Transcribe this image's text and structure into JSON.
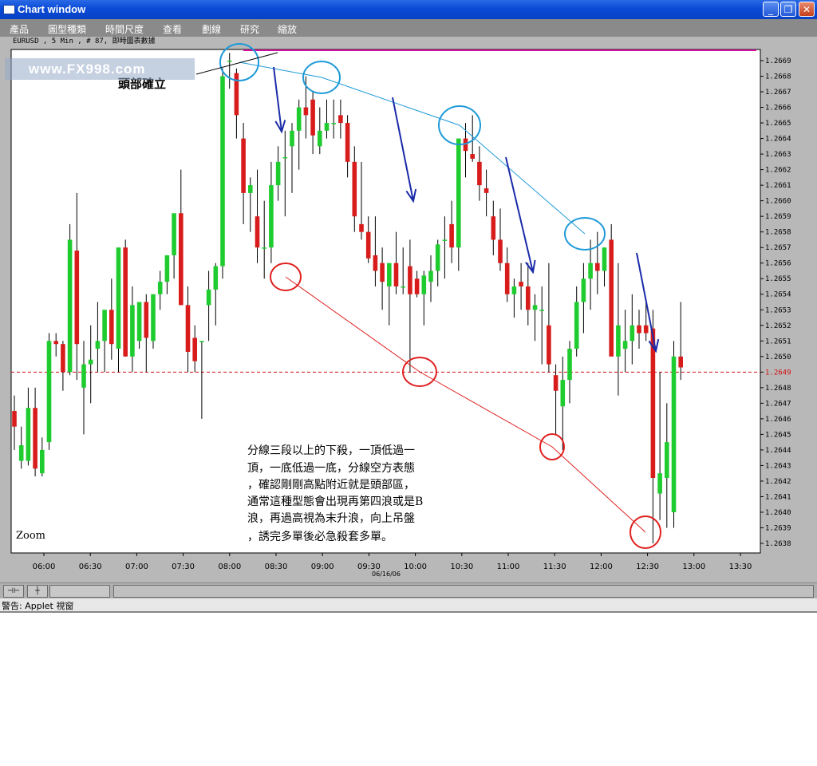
{
  "window": {
    "title": "Chart window",
    "controls": [
      "_",
      "❐",
      "✕"
    ]
  },
  "menu": [
    "產品",
    "圖型種類",
    "時間尺度",
    "查看",
    "劃線",
    "研究",
    "縮放"
  ],
  "info_line": "EURUSD , 5 Min , # 87, 即時圖表數據",
  "watermark": "www.FX998.com",
  "status": "警告: Applet 視窗",
  "colors": {
    "up": "#1fcc2f",
    "down": "#d81c1c",
    "resistance": "#1e9ad8",
    "support": "#e02020",
    "arrow": "#1a2ba8",
    "top_line": "#d0109c"
  },
  "chart_data": {
    "type": "candlestick",
    "symbol": "EURUSD",
    "timeframe": "5 Min",
    "date": "06/16/06",
    "x_ticks": [
      "06:00",
      "06:30",
      "07:00",
      "07:30",
      "08:00",
      "08:30",
      "09:00",
      "09:30",
      "10:00",
      "10:30",
      "11:00",
      "11:30",
      "12:00",
      "12:30",
      "13:00",
      "13:30"
    ],
    "y_ticks": [
      "1.2669",
      "1.2668",
      "1.2667",
      "1.2666",
      "1.2665",
      "1.2664",
      "1.2663",
      "1.2662",
      "1.2661",
      "1.2660",
      "1.2659",
      "1.2658",
      "1.2657",
      "1.2656",
      "1.2655",
      "1.2654",
      "1.2653",
      "1.2652",
      "1.2651",
      "1.2650",
      "1.2649",
      "1.2648",
      "1.2647",
      "1.2646",
      "1.2645",
      "1.2644",
      "1.2643",
      "1.2642",
      "1.2641",
      "1.2640",
      "1.2639",
      "1.2638"
    ],
    "current_price": "1.2649",
    "ylim": [
      1.26375,
      1.26695
    ],
    "candles": [
      {
        "o": 1.26465,
        "h": 1.26475,
        "l": 1.2644,
        "c": 1.26455
      },
      {
        "o": 1.26433,
        "h": 1.26455,
        "l": 1.26428,
        "c": 1.26443
      },
      {
        "o": 1.26433,
        "h": 1.2648,
        "l": 1.2643,
        "c": 1.26467
      },
      {
        "o": 1.26467,
        "h": 1.2648,
        "l": 1.26423,
        "c": 1.26428
      },
      {
        "o": 1.26425,
        "h": 1.26448,
        "l": 1.26423,
        "c": 1.2644
      },
      {
        "o": 1.26445,
        "h": 1.26515,
        "l": 1.2644,
        "c": 1.2651
      },
      {
        "o": 1.2651,
        "h": 1.26515,
        "l": 1.265,
        "c": 1.26508
      },
      {
        "o": 1.26508,
        "h": 1.2651,
        "l": 1.26478,
        "c": 1.2649
      },
      {
        "o": 1.2649,
        "h": 1.26585,
        "l": 1.26488,
        "c": 1.26575
      },
      {
        "o": 1.26568,
        "h": 1.26605,
        "l": 1.26485,
        "c": 1.26508
      },
      {
        "o": 1.2648,
        "h": 1.2651,
        "l": 1.2645,
        "c": 1.26495
      },
      {
        "o": 1.26495,
        "h": 1.2652,
        "l": 1.2647,
        "c": 1.26498
      },
      {
        "o": 1.26505,
        "h": 1.26535,
        "l": 1.2649,
        "c": 1.2651
      },
      {
        "o": 1.2651,
        "h": 1.2653,
        "l": 1.2649,
        "c": 1.2653
      },
      {
        "o": 1.2653,
        "h": 1.2655,
        "l": 1.26498,
        "c": 1.26508
      },
      {
        "o": 1.26505,
        "h": 1.2657,
        "l": 1.2649,
        "c": 1.2657
      },
      {
        "o": 1.2657,
        "h": 1.26575,
        "l": 1.265,
        "c": 1.265
      },
      {
        "o": 1.265,
        "h": 1.26545,
        "l": 1.2649,
        "c": 1.26533
      },
      {
        "o": 1.2651,
        "h": 1.26535,
        "l": 1.26505,
        "c": 1.26535
      },
      {
        "o": 1.26535,
        "h": 1.2654,
        "l": 1.2649,
        "c": 1.26512
      },
      {
        "o": 1.2651,
        "h": 1.2654,
        "l": 1.26505,
        "c": 1.2654
      },
      {
        "o": 1.2654,
        "h": 1.26555,
        "l": 1.2653,
        "c": 1.26548
      },
      {
        "o": 1.26548,
        "h": 1.26565,
        "l": 1.2654,
        "c": 1.26565
      },
      {
        "o": 1.26565,
        "h": 1.26585,
        "l": 1.2655,
        "c": 1.26592
      },
      {
        "o": 1.26592,
        "h": 1.2662,
        "l": 1.26555,
        "c": 1.26533
      },
      {
        "o": 1.26533,
        "h": 1.26545,
        "l": 1.2649,
        "c": 1.26503
      },
      {
        "o": 1.26512,
        "h": 1.2652,
        "l": 1.2649,
        "c": 1.26497
      },
      {
        "o": 1.2651,
        "h": 1.2651,
        "l": 1.2646,
        "c": 1.2651
      },
      {
        "o": 1.26533,
        "h": 1.26555,
        "l": 1.2651,
        "c": 1.26543
      },
      {
        "o": 1.26543,
        "h": 1.2656,
        "l": 1.2652,
        "c": 1.26558
      },
      {
        "o": 1.26558,
        "h": 1.26685,
        "l": 1.2655,
        "c": 1.2668
      },
      {
        "o": 1.2669,
        "h": 1.26695,
        "l": 1.26672,
        "c": 1.2669
      },
      {
        "o": 1.26682,
        "h": 1.26685,
        "l": 1.2664,
        "c": 1.26655
      },
      {
        "o": 1.2664,
        "h": 1.2665,
        "l": 1.26585,
        "c": 1.26605
      },
      {
        "o": 1.26605,
        "h": 1.26615,
        "l": 1.2658,
        "c": 1.2661
      },
      {
        "o": 1.2659,
        "h": 1.2662,
        "l": 1.2656,
        "c": 1.2657
      },
      {
        "o": 1.2657,
        "h": 1.266,
        "l": 1.2655,
        "c": 1.2657
      },
      {
        "o": 1.2657,
        "h": 1.26625,
        "l": 1.2656,
        "c": 1.2661
      },
      {
        "o": 1.2661,
        "h": 1.26635,
        "l": 1.266,
        "c": 1.26625
      },
      {
        "o": 1.26628,
        "h": 1.26645,
        "l": 1.2659,
        "c": 1.26628
      },
      {
        "o": 1.26635,
        "h": 1.2665,
        "l": 1.26605,
        "c": 1.26645
      },
      {
        "o": 1.26645,
        "h": 1.26665,
        "l": 1.2662,
        "c": 1.2666
      },
      {
        "o": 1.2666,
        "h": 1.2668,
        "l": 1.2664,
        "c": 1.26655
      },
      {
        "o": 1.26665,
        "h": 1.2667,
        "l": 1.2663,
        "c": 1.26642
      },
      {
        "o": 1.26635,
        "h": 1.2666,
        "l": 1.2663,
        "c": 1.26645
      },
      {
        "o": 1.26645,
        "h": 1.26665,
        "l": 1.2664,
        "c": 1.2665
      },
      {
        "o": 1.2665,
        "h": 1.26665,
        "l": 1.2664,
        "c": 1.2665
      },
      {
        "o": 1.26655,
        "h": 1.26665,
        "l": 1.2664,
        "c": 1.2665
      },
      {
        "o": 1.2665,
        "h": 1.26655,
        "l": 1.26615,
        "c": 1.26625
      },
      {
        "o": 1.26625,
        "h": 1.26635,
        "l": 1.2658,
        "c": 1.2659
      },
      {
        "o": 1.26585,
        "h": 1.26625,
        "l": 1.26575,
        "c": 1.2658
      },
      {
        "o": 1.2658,
        "h": 1.2659,
        "l": 1.2656,
        "c": 1.26563
      },
      {
        "o": 1.26565,
        "h": 1.2659,
        "l": 1.26545,
        "c": 1.26555
      },
      {
        "o": 1.2656,
        "h": 1.2657,
        "l": 1.2653,
        "c": 1.26548
      },
      {
        "o": 1.26545,
        "h": 1.2656,
        "l": 1.2652,
        "c": 1.2656
      },
      {
        "o": 1.2656,
        "h": 1.2658,
        "l": 1.2654,
        "c": 1.26545
      },
      {
        "o": 1.26545,
        "h": 1.2657,
        "l": 1.2654,
        "c": 1.26545
      },
      {
        "o": 1.26558,
        "h": 1.26575,
        "l": 1.2649,
        "c": 1.2654
      },
      {
        "o": 1.2655,
        "h": 1.26555,
        "l": 1.26538,
        "c": 1.2654
      },
      {
        "o": 1.2654,
        "h": 1.26555,
        "l": 1.2652,
        "c": 1.26552
      },
      {
        "o": 1.26548,
        "h": 1.26565,
        "l": 1.26535,
        "c": 1.26555
      },
      {
        "o": 1.26555,
        "h": 1.26575,
        "l": 1.26545,
        "c": 1.26572
      },
      {
        "o": 1.26575,
        "h": 1.2659,
        "l": 1.2655,
        "c": 1.26575
      },
      {
        "o": 1.26585,
        "h": 1.266,
        "l": 1.2656,
        "c": 1.2657
      },
      {
        "o": 1.2657,
        "h": 1.2662,
        "l": 1.26555,
        "c": 1.2664
      },
      {
        "o": 1.2664,
        "h": 1.2665,
        "l": 1.26615,
        "c": 1.26632
      },
      {
        "o": 1.2663,
        "h": 1.26655,
        "l": 1.26625,
        "c": 1.26627
      },
      {
        "o": 1.26625,
        "h": 1.26635,
        "l": 1.266,
        "c": 1.2661
      },
      {
        "o": 1.26608,
        "h": 1.2662,
        "l": 1.2659,
        "c": 1.26605
      },
      {
        "o": 1.2659,
        "h": 1.266,
        "l": 1.26565,
        "c": 1.26575
      },
      {
        "o": 1.26575,
        "h": 1.26595,
        "l": 1.26555,
        "c": 1.2656
      },
      {
        "o": 1.2656,
        "h": 1.2657,
        "l": 1.26535,
        "c": 1.2654
      },
      {
        "o": 1.2654,
        "h": 1.2655,
        "l": 1.26525,
        "c": 1.26545
      },
      {
        "o": 1.26548,
        "h": 1.2656,
        "l": 1.2653,
        "c": 1.26545
      },
      {
        "o": 1.26545,
        "h": 1.2656,
        "l": 1.2652,
        "c": 1.2653
      },
      {
        "o": 1.2653,
        "h": 1.2654,
        "l": 1.2651,
        "c": 1.26533
      },
      {
        "o": 1.2653,
        "h": 1.26545,
        "l": 1.26495,
        "c": 1.2653
      },
      {
        "o": 1.2652,
        "h": 1.2656,
        "l": 1.2649,
        "c": 1.26495
      },
      {
        "o": 1.26488,
        "h": 1.26495,
        "l": 1.2645,
        "c": 1.26478
      },
      {
        "o": 1.26468,
        "h": 1.265,
        "l": 1.2644,
        "c": 1.26485
      },
      {
        "o": 1.26485,
        "h": 1.2651,
        "l": 1.2647,
        "c": 1.26505
      },
      {
        "o": 1.26505,
        "h": 1.26545,
        "l": 1.265,
        "c": 1.26535
      },
      {
        "o": 1.26535,
        "h": 1.2656,
        "l": 1.26515,
        "c": 1.2655
      },
      {
        "o": 1.2655,
        "h": 1.26575,
        "l": 1.2653,
        "c": 1.2656
      },
      {
        "o": 1.2656,
        "h": 1.2658,
        "l": 1.2654,
        "c": 1.26555
      },
      {
        "o": 1.26555,
        "h": 1.2657,
        "l": 1.26545,
        "c": 1.2657
      },
      {
        "o": 1.26575,
        "h": 1.26585,
        "l": 1.2652,
        "c": 1.265
      },
      {
        "o": 1.265,
        "h": 1.2656,
        "l": 1.26475,
        "c": 1.2652
      },
      {
        "o": 1.26505,
        "h": 1.2653,
        "l": 1.2649,
        "c": 1.2651
      },
      {
        "o": 1.2651,
        "h": 1.2654,
        "l": 1.26495,
        "c": 1.2652
      },
      {
        "o": 1.2652,
        "h": 1.2653,
        "l": 1.26505,
        "c": 1.26515
      },
      {
        "o": 1.2652,
        "h": 1.26535,
        "l": 1.2651,
        "c": 1.26515
      },
      {
        "o": 1.26518,
        "h": 1.2653,
        "l": 1.2638,
        "c": 1.26422
      },
      {
        "o": 1.26412,
        "h": 1.2649,
        "l": 1.26395,
        "c": 1.26425
      },
      {
        "o": 1.26422,
        "h": 1.2647,
        "l": 1.2639,
        "c": 1.26445
      },
      {
        "o": 1.264,
        "h": 1.2651,
        "l": 1.2639,
        "c": 1.265
      },
      {
        "o": 1.265,
        "h": 1.26535,
        "l": 1.26485,
        "c": 1.26493
      }
    ],
    "annotations": {
      "head_label": "頭部確立",
      "text_lines": [
        "分線三段以上的下殺，一頂低過一",
        "頂，一底低過一底，分線空方表態",
        "，確認剛剛高點附近就是頭部區，",
        "通常這種型態會出現再第四浪或是B",
        "浪，再過高視為末升浪，向上吊盤",
        "，誘完多單後必急殺套多單。"
      ],
      "zoom": "Zoom"
    }
  }
}
